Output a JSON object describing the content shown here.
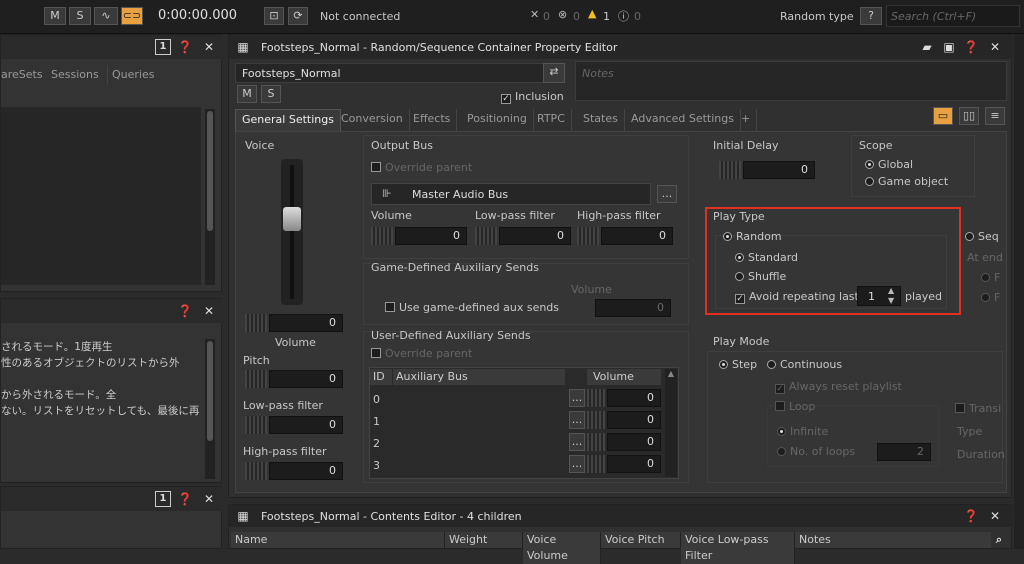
{
  "toolbar": {
    "m_label": "M",
    "s_label": "S",
    "timecode": "0:00:00.000",
    "connection": "Not connected",
    "err1": "0",
    "err2": "0",
    "warn": "1",
    "info": "0",
    "random_type": "Random type",
    "help": "?",
    "search_placeholder": "Search (Ctrl+F)"
  },
  "left": {
    "tabs": [
      "areSets",
      "Sessions",
      "Queries"
    ],
    "help_lines": [
      "されるモード。1度再生",
      "性のあるオブジェクトのリストから外",
      "",
      "から外されるモード。全",
      "ない。リストをリセットしても、最後に再"
    ]
  },
  "editor": {
    "title": "Footsteps_Normal - Random/Sequence Container Property Editor",
    "name": "Footsteps_Normal",
    "notes_placeholder": "Notes",
    "inclusion": "Inclusion",
    "tabs": [
      "General Settings",
      "Conversion",
      "Effects",
      "Positioning",
      "RTPC",
      "States",
      "Advanced Settings",
      "+"
    ],
    "voice": {
      "title": "Voice",
      "volume_value": "0",
      "volume_label": "Volume",
      "pitch_label": "Pitch",
      "pitch_value": "0",
      "lpf_label": "Low-pass filter",
      "lpf_value": "0",
      "hpf_label": "High-pass filter",
      "hpf_value": "0"
    },
    "output_bus": {
      "title": "Output Bus",
      "override": "Override parent",
      "bus_name": "Master Audio Bus",
      "more": "...",
      "volume_label": "Volume",
      "lpf_label": "Low-pass filter",
      "hpf_label": "High-pass filter",
      "volume": "0",
      "lpf": "0",
      "hpf": "0"
    },
    "game_aux": {
      "title": "Game-Defined Auxiliary Sends",
      "volume_label": "Volume",
      "use_label": "Use game-defined aux sends",
      "volume": "0"
    },
    "user_aux": {
      "title": "User-Defined Auxiliary Sends",
      "override": "Override parent",
      "col_id": "ID",
      "col_bus": "Auxiliary Bus",
      "col_volume": "Volume",
      "rows": [
        {
          "id": "0",
          "volume": "0"
        },
        {
          "id": "1",
          "volume": "0"
        },
        {
          "id": "2",
          "volume": "0"
        },
        {
          "id": "3",
          "volume": "0"
        }
      ]
    },
    "initial_delay": {
      "title": "Initial Delay",
      "value": "0"
    },
    "scope": {
      "title": "Scope",
      "global": "Global",
      "game_object": "Game object"
    },
    "play_type": {
      "title": "Play Type",
      "random": "Random",
      "standard": "Standard",
      "shuffle": "Shuffle",
      "avoid": "Avoid repeating last",
      "avoid_value": "1",
      "played": "played",
      "sequence": "Seq",
      "at_end": "At end",
      "r1": "F",
      "r2": "F"
    },
    "play_mode": {
      "title": "Play Mode",
      "step": "Step",
      "continuous": "Continuous",
      "always_reset": "Always reset playlist",
      "loop": "Loop",
      "infinite": "Infinite",
      "no_loops": "No. of loops",
      "loops_value": "2",
      "transitions": "Transi",
      "type": "Type",
      "duration": "Duration"
    }
  },
  "contents": {
    "title": "Footsteps_Normal - Contents Editor - 4 children",
    "columns": [
      "Name",
      "Weight",
      "Voice Volume",
      "Voice Pitch",
      "Voice Low-pass Filter",
      "Notes"
    ]
  },
  "colors": {
    "highlight": "#e03020",
    "accent": "#e8a040"
  }
}
